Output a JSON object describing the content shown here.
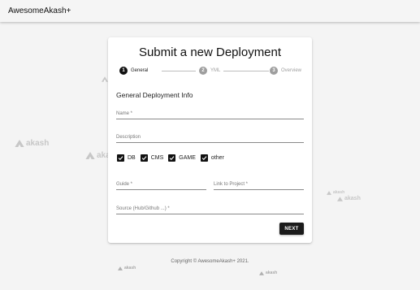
{
  "app": {
    "title": "AwesomeAkash+"
  },
  "watermark": {
    "text": "akash"
  },
  "card": {
    "title": "Submit a new Deployment",
    "stepper": [
      {
        "number": "1",
        "label": "General",
        "active": true
      },
      {
        "number": "2",
        "label": "YML",
        "active": false
      },
      {
        "number": "3",
        "label": "Overview",
        "active": false
      }
    ],
    "section_title": "General Deployment Info",
    "fields": {
      "name": {
        "label": "Name *",
        "value": ""
      },
      "description": {
        "label": "Description",
        "value": ""
      },
      "guide": {
        "label": "Guide *",
        "value": ""
      },
      "link": {
        "label": "Link to Project *",
        "value": ""
      },
      "source": {
        "label": "Source (Hub/Github ...) *",
        "value": ""
      }
    },
    "checkboxes": [
      {
        "label": "DB",
        "checked": true
      },
      {
        "label": "CMS",
        "checked": true
      },
      {
        "label": "GAME",
        "checked": true
      },
      {
        "label": "other",
        "checked": true
      }
    ],
    "next_button": "NEXT"
  },
  "footer": {
    "text": "Copyright © AwesomeAkash+ 2021."
  },
  "colors": {
    "primary": "#111111",
    "inactive": "#9e9e9e",
    "watermark": "#c7c7c7",
    "background": "#f4f4f4"
  }
}
